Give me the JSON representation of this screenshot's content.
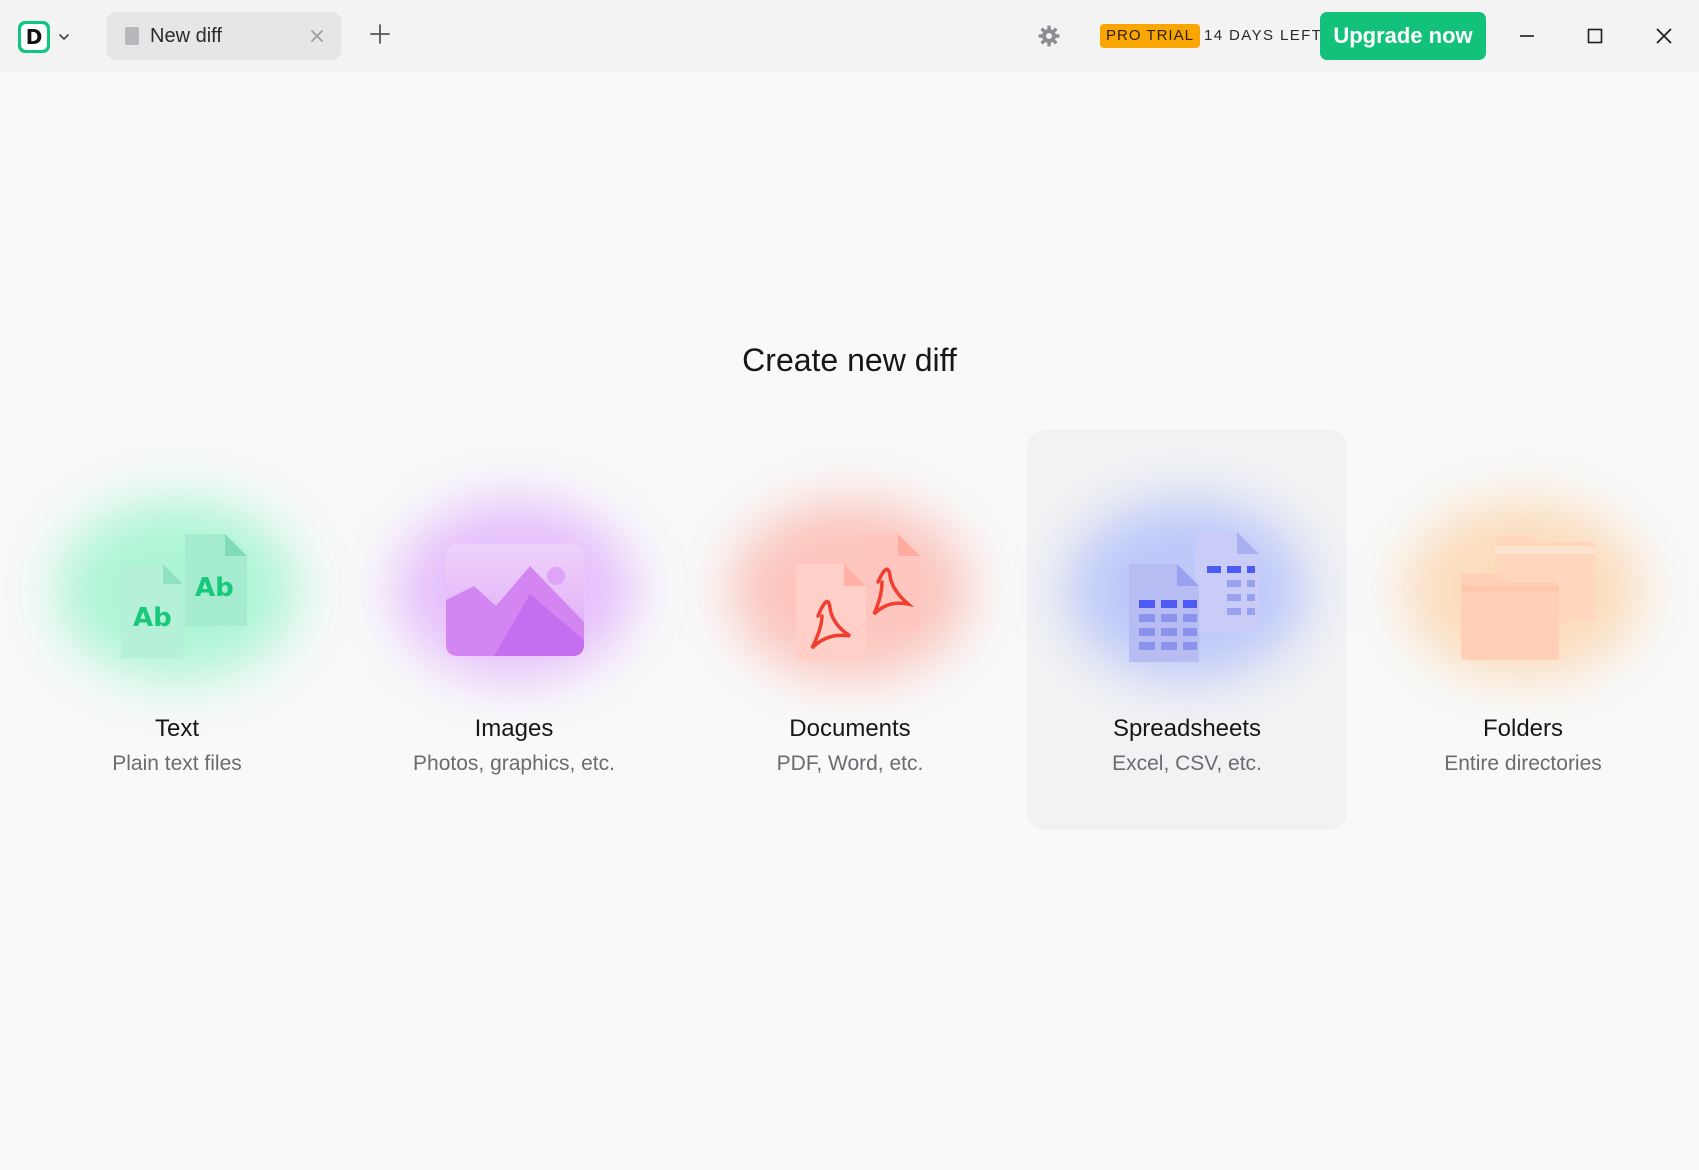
{
  "titlebar": {
    "logo_letter": "D",
    "tab": {
      "label": "New diff"
    },
    "badge": "PRO TRIAL",
    "days_left": "14 DAYS LEFT",
    "upgrade_label": "Upgrade now"
  },
  "main": {
    "heading": "Create new diff",
    "cards": [
      {
        "title": "Text",
        "subtitle": "Plain text files",
        "icon": "text-files-icon",
        "color": "#2fd68f"
      },
      {
        "title": "Images",
        "subtitle": "Photos, graphics, etc.",
        "icon": "image-icon",
        "color": "#c26cf5"
      },
      {
        "title": "Documents",
        "subtitle": "PDF, Word, etc.",
        "icon": "pdf-documents-icon",
        "color": "#ff7b6b"
      },
      {
        "title": "Spreadsheets",
        "subtitle": "Excel, CSV, etc.",
        "icon": "spreadsheet-icon",
        "color": "#7a86f0"
      },
      {
        "title": "Folders",
        "subtitle": "Entire directories",
        "icon": "folder-icon",
        "color": "#ffb36b"
      }
    ]
  },
  "colors": {
    "accent": "#12c27b",
    "badge": "#f9a600"
  }
}
